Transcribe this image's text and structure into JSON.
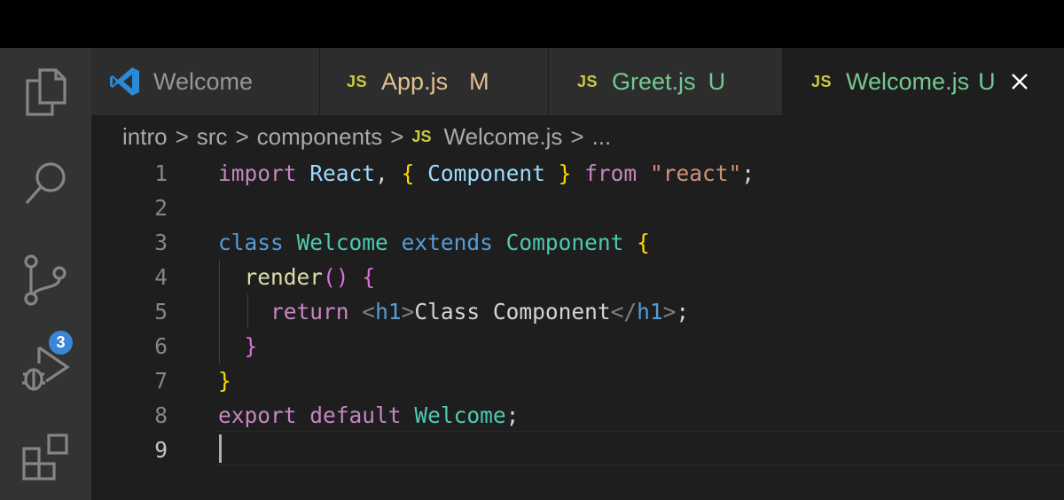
{
  "tabs": [
    {
      "label": "Welcome",
      "status": "",
      "icon": "vscode-logo-icon",
      "color": "#969696"
    },
    {
      "label": "App.js",
      "status": "M",
      "icon": "js-file-icon",
      "color": "#e2c08d"
    },
    {
      "label": "Greet.js",
      "status": "U",
      "icon": "js-file-icon",
      "color": "#73c991"
    },
    {
      "label": "Welcome.js",
      "status": "U",
      "icon": "js-file-icon",
      "color": "#73c991",
      "active": true
    }
  ],
  "js_icon_text": "JS",
  "breadcrumbs": [
    "intro",
    "src",
    "components",
    "Welcome.js",
    "..."
  ],
  "breadcrumb_separator": ">",
  "source_control_badge": "3",
  "line_numbers": [
    "1",
    "2",
    "3",
    "4",
    "5",
    "6",
    "7",
    "8",
    "9"
  ],
  "code": {
    "l1": {
      "t0": "import",
      "t1": " ",
      "t2": "React",
      "t3": ", ",
      "t4": "{",
      "t5": " ",
      "t6": "Component",
      "t7": " ",
      "t8": "}",
      "t9": " ",
      "t10": "from",
      "t11": " ",
      "t12": "\"react\"",
      "t13": ";"
    },
    "l3": {
      "t0": "class",
      "t1": " ",
      "t2": "Welcome",
      "t3": " ",
      "t4": "extends",
      "t5": " ",
      "t6": "Component",
      "t7": " ",
      "t8": "{"
    },
    "l4": {
      "t0": "  ",
      "t1": "render",
      "t2": "()",
      "t3": " ",
      "t4": "{"
    },
    "l5": {
      "t0": "    ",
      "t1": "return",
      "t2": " ",
      "t3": "<",
      "t4": "h1",
      "t5": ">",
      "t6": "Class Component",
      "t7": "</",
      "t8": "h1",
      "t9": ">",
      "t10": ";"
    },
    "l6": {
      "t0": "  ",
      "t1": "}"
    },
    "l7": {
      "t0": "}"
    },
    "l8": {
      "t0": "export",
      "t1": " ",
      "t2": "default",
      "t3": " ",
      "t4": "Welcome",
      "t5": ";"
    }
  },
  "colors": {
    "modified": "#e2c08d",
    "untracked": "#73c991",
    "badge": "#3b86d6",
    "js_icon": "#cbcb41"
  }
}
